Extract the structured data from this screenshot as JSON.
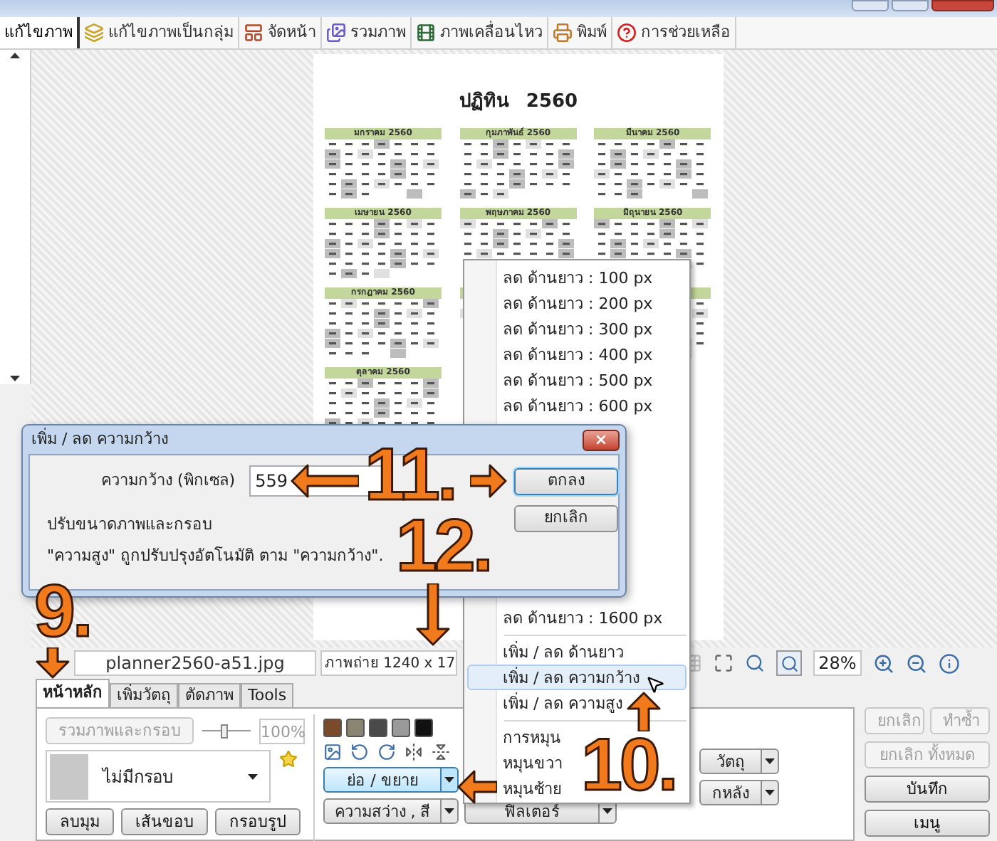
{
  "tabs": [
    {
      "label": "แก้ไขภาพ",
      "selected": true
    },
    {
      "label": "แก้ไขภาพเป็นกลุ่ม",
      "selected": false
    },
    {
      "label": "จัดหน้า",
      "selected": false
    },
    {
      "label": "รวมภาพ",
      "selected": false
    },
    {
      "label": "ภาพเคลื่อนไหว",
      "selected": false
    },
    {
      "label": "พิมพ์",
      "selected": false
    },
    {
      "label": "การช่วยเหลือ",
      "selected": false
    }
  ],
  "preview": {
    "title": "ปฏิทิน",
    "year": "2560",
    "months": [
      {
        "title": "มกราคม 2560"
      },
      {
        "title": "กุมภาพันธ์ 2560"
      },
      {
        "title": "มีนาคม 2560"
      },
      {
        "title": "เมษายน 2560"
      },
      {
        "title": "พฤษภาคม 2560"
      },
      {
        "title": "มิถุนายน 2560"
      },
      {
        "title": "กรกฎาคม 2560"
      },
      {
        "covered": true
      },
      {
        "covered": true
      },
      {
        "title": "ตุลาคม 2560"
      }
    ]
  },
  "status": {
    "filename": "planner2560-a51.jpg",
    "info": "ภาพถ่าย 1240 x 17",
    "zoom": "28%"
  },
  "bottom_tabs": [
    {
      "label": "หน้าหลัก",
      "selected": true
    },
    {
      "label": "เพิ่มวัตถุ",
      "selected": false
    },
    {
      "label": "ตัดภาพ",
      "selected": false
    },
    {
      "label": "Tools",
      "selected": false
    }
  ],
  "panel": {
    "merge_button": {
      "label": "รวมภาพและกรอบ",
      "disabled": true
    },
    "opacity": {
      "level": 0.45,
      "value": "100%"
    },
    "frame": "ไม่มีกรอบ",
    "frame_buttons": [
      "ลบมุม",
      "เส้นขอบ",
      "กรอบรูป"
    ],
    "swatches": [
      {
        "color": "#7b4a2b"
      },
      {
        "color": "#8a8570"
      },
      {
        "color": "#4a4a4a"
      },
      {
        "color": "#9a9a9a"
      },
      {
        "color": "#111111"
      }
    ],
    "resize_button": {
      "label": "ย่อ / ขยาย",
      "highlighted": true
    },
    "brightness_button": "ความสว่าง , สี",
    "filter_button": "ฟิลเตอร์",
    "object_button": "วัตถุ",
    "background_button": "กหลัง"
  },
  "actions": [
    {
      "label": "ยกเลิก",
      "disabled": true
    },
    {
      "label": "ทำซ้ำ",
      "disabled": true
    },
    {
      "label": "ยกเลิก ทั้งหมด",
      "disabled": true
    },
    {
      "label": "บันทึก",
      "disabled": false
    },
    {
      "label": "เมนู",
      "disabled": false
    }
  ],
  "menu": {
    "items": [
      {
        "kind": "item",
        "label": "ลด ด้านยาว : 100 px",
        "selected": false
      },
      {
        "kind": "item",
        "label": "ลด ด้านยาว : 200 px",
        "selected": false
      },
      {
        "kind": "item",
        "label": "ลด ด้านยาว : 300 px",
        "selected": false
      },
      {
        "kind": "item",
        "label": "ลด ด้านยาว : 400 px",
        "selected": false
      },
      {
        "kind": "item",
        "label": "ลด ด้านยาว : 500 px",
        "selected": false
      },
      {
        "kind": "item",
        "label": "ลด ด้านยาว : 600 px",
        "selected": false
      },
      {
        "kind": "item",
        "label": "ลด ด้านยาว : 1600 px",
        "selected": false
      },
      {
        "kind": "separator"
      },
      {
        "kind": "item",
        "label": "เพิ่ม / ลด ด้านยาว",
        "selected": false
      },
      {
        "kind": "item",
        "label": "เพิ่ม / ลด ความกว้าง",
        "selected": true
      },
      {
        "kind": "item",
        "label": "เพิ่ม / ลด ความสูง",
        "selected": false
      },
      {
        "kind": "separator"
      },
      {
        "kind": "item",
        "label": "การหมุน",
        "selected": false
      },
      {
        "kind": "item",
        "label": "หมุนขวา",
        "selected": false
      },
      {
        "kind": "item",
        "label": "หมุนซ้าย",
        "selected": false
      }
    ]
  },
  "dialog": {
    "title": "เพิ่ม / ลด ความกว้าง",
    "field_label": "ความกว้าง (พิกเซล)",
    "value": "559",
    "ok": "ตกลง",
    "cancel": "ยกเลิก",
    "heading": "ปรับขนาดภาพและกรอบ",
    "note": "\"ความสูง\" ถูกปรับปรุงอัตโนมัติ ตาม  \"ความกว้าง\"."
  },
  "annotations": [
    {
      "label": "9."
    },
    {
      "label": "10."
    },
    {
      "label": "11."
    },
    {
      "label": "12."
    }
  ]
}
